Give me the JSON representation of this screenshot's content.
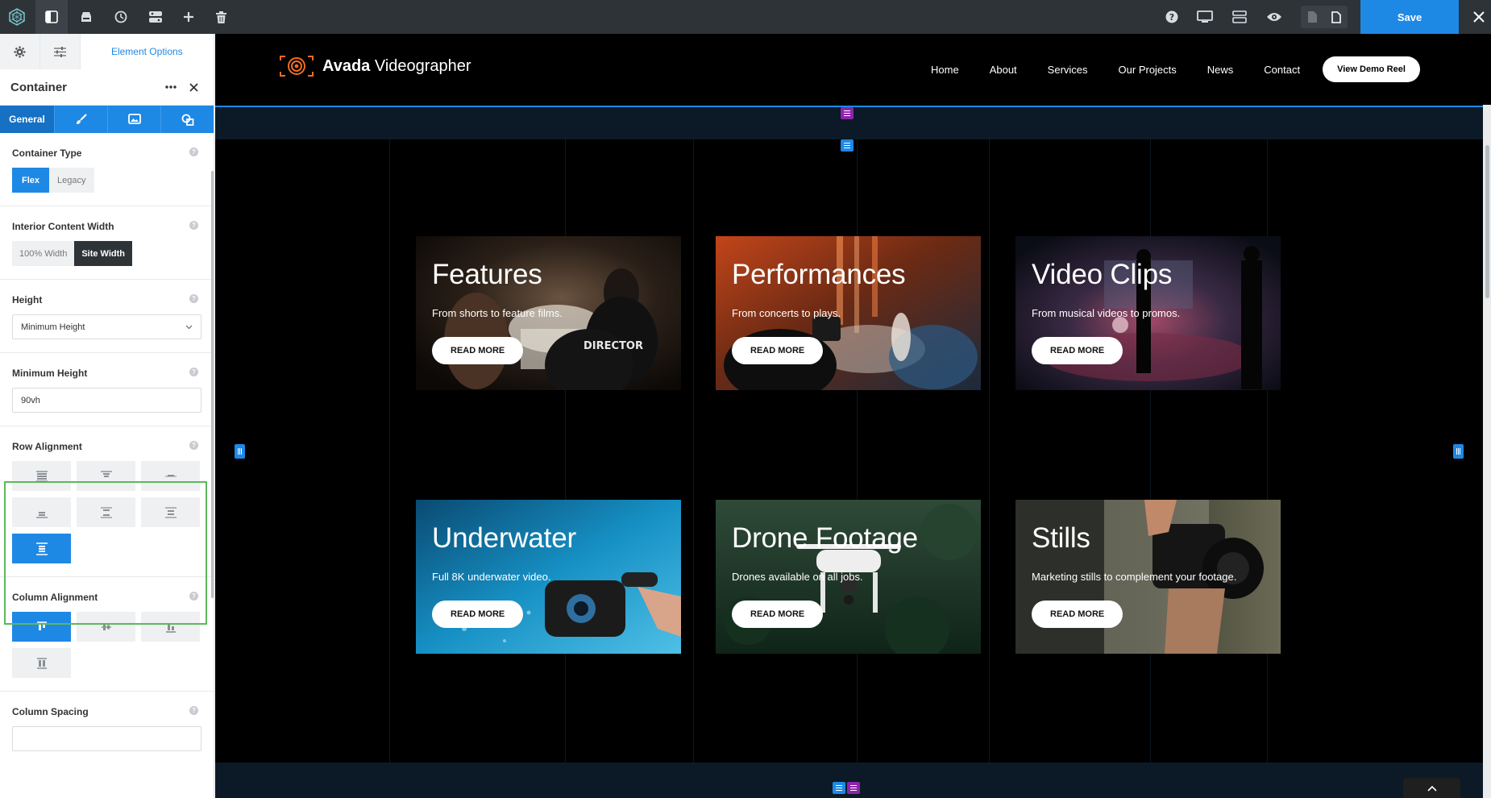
{
  "toolbar": {
    "save_label": "Save",
    "icons": [
      "builder-logo-icon",
      "sidebar-toggle-icon",
      "library-icon",
      "history-icon",
      "layout-icon",
      "add-icon",
      "trash-icon",
      "help-icon",
      "desktop-icon",
      "navigator-icon",
      "preview-icon",
      "page-icon",
      "document-icon",
      "close-icon"
    ]
  },
  "sidebar": {
    "tab_label": "Element Options",
    "panel_title": "Container",
    "subtab_general": "General",
    "container_type": {
      "label": "Container Type",
      "options": [
        "Flex",
        "Legacy"
      ],
      "selected": "Flex"
    },
    "interior_width": {
      "label": "Interior Content Width",
      "options": [
        "100% Width",
        "Site Width"
      ],
      "selected": "Site Width"
    },
    "height": {
      "label": "Height",
      "value": "Minimum Height"
    },
    "min_height": {
      "label": "Minimum Height",
      "value": "90vh"
    },
    "row_alignment": {
      "label": "Row Alignment",
      "selected_index": 6
    },
    "column_alignment": {
      "label": "Column Alignment",
      "selected_index": 0
    },
    "column_spacing": {
      "label": "Column Spacing",
      "value": ""
    }
  },
  "site": {
    "brand_bold": "Avada",
    "brand_rest": "Videographer",
    "nav": [
      "Home",
      "About",
      "Services",
      "Our Projects",
      "News",
      "Contact"
    ],
    "cta": "View Demo Reel",
    "cards": [
      {
        "title": "Features",
        "subtitle": "From shorts to feature films.",
        "button": "READ MORE"
      },
      {
        "title": "Performances",
        "subtitle": "From concerts to plays.",
        "button": "READ MORE"
      },
      {
        "title": "Video Clips",
        "subtitle": "From musical videos to promos.",
        "button": "READ MORE"
      },
      {
        "title": "Underwater",
        "subtitle": "Full 8K underwater video.",
        "button": "READ MORE"
      },
      {
        "title": "Drone Footage",
        "subtitle": "Drones available on all jobs.",
        "button": "READ MORE"
      },
      {
        "title": "Stills",
        "subtitle": "Marketing stills to complement your footage.",
        "button": "READ MORE"
      }
    ]
  },
  "colors": {
    "accent": "#1e88e5",
    "toolbar_bg": "#2e3338",
    "highlight": "#5cb85c",
    "logo_orange": "#f26b21"
  }
}
